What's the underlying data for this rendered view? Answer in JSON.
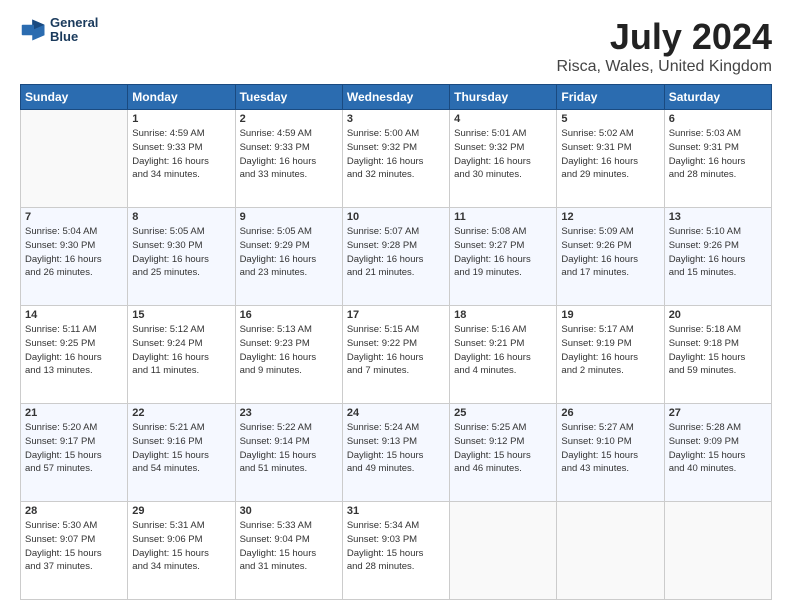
{
  "logo": {
    "line1": "General",
    "line2": "Blue"
  },
  "title": "July 2024",
  "subtitle": "Risca, Wales, United Kingdom",
  "days_of_week": [
    "Sunday",
    "Monday",
    "Tuesday",
    "Wednesday",
    "Thursday",
    "Friday",
    "Saturday"
  ],
  "weeks": [
    [
      {
        "day": "",
        "info": ""
      },
      {
        "day": "1",
        "info": "Sunrise: 4:59 AM\nSunset: 9:33 PM\nDaylight: 16 hours\nand 34 minutes."
      },
      {
        "day": "2",
        "info": "Sunrise: 4:59 AM\nSunset: 9:33 PM\nDaylight: 16 hours\nand 33 minutes."
      },
      {
        "day": "3",
        "info": "Sunrise: 5:00 AM\nSunset: 9:32 PM\nDaylight: 16 hours\nand 32 minutes."
      },
      {
        "day": "4",
        "info": "Sunrise: 5:01 AM\nSunset: 9:32 PM\nDaylight: 16 hours\nand 30 minutes."
      },
      {
        "day": "5",
        "info": "Sunrise: 5:02 AM\nSunset: 9:31 PM\nDaylight: 16 hours\nand 29 minutes."
      },
      {
        "day": "6",
        "info": "Sunrise: 5:03 AM\nSunset: 9:31 PM\nDaylight: 16 hours\nand 28 minutes."
      }
    ],
    [
      {
        "day": "7",
        "info": "Sunrise: 5:04 AM\nSunset: 9:30 PM\nDaylight: 16 hours\nand 26 minutes."
      },
      {
        "day": "8",
        "info": "Sunrise: 5:05 AM\nSunset: 9:30 PM\nDaylight: 16 hours\nand 25 minutes."
      },
      {
        "day": "9",
        "info": "Sunrise: 5:05 AM\nSunset: 9:29 PM\nDaylight: 16 hours\nand 23 minutes."
      },
      {
        "day": "10",
        "info": "Sunrise: 5:07 AM\nSunset: 9:28 PM\nDaylight: 16 hours\nand 21 minutes."
      },
      {
        "day": "11",
        "info": "Sunrise: 5:08 AM\nSunset: 9:27 PM\nDaylight: 16 hours\nand 19 minutes."
      },
      {
        "day": "12",
        "info": "Sunrise: 5:09 AM\nSunset: 9:26 PM\nDaylight: 16 hours\nand 17 minutes."
      },
      {
        "day": "13",
        "info": "Sunrise: 5:10 AM\nSunset: 9:26 PM\nDaylight: 16 hours\nand 15 minutes."
      }
    ],
    [
      {
        "day": "14",
        "info": "Sunrise: 5:11 AM\nSunset: 9:25 PM\nDaylight: 16 hours\nand 13 minutes."
      },
      {
        "day": "15",
        "info": "Sunrise: 5:12 AM\nSunset: 9:24 PM\nDaylight: 16 hours\nand 11 minutes."
      },
      {
        "day": "16",
        "info": "Sunrise: 5:13 AM\nSunset: 9:23 PM\nDaylight: 16 hours\nand 9 minutes."
      },
      {
        "day": "17",
        "info": "Sunrise: 5:15 AM\nSunset: 9:22 PM\nDaylight: 16 hours\nand 7 minutes."
      },
      {
        "day": "18",
        "info": "Sunrise: 5:16 AM\nSunset: 9:21 PM\nDaylight: 16 hours\nand 4 minutes."
      },
      {
        "day": "19",
        "info": "Sunrise: 5:17 AM\nSunset: 9:19 PM\nDaylight: 16 hours\nand 2 minutes."
      },
      {
        "day": "20",
        "info": "Sunrise: 5:18 AM\nSunset: 9:18 PM\nDaylight: 15 hours\nand 59 minutes."
      }
    ],
    [
      {
        "day": "21",
        "info": "Sunrise: 5:20 AM\nSunset: 9:17 PM\nDaylight: 15 hours\nand 57 minutes."
      },
      {
        "day": "22",
        "info": "Sunrise: 5:21 AM\nSunset: 9:16 PM\nDaylight: 15 hours\nand 54 minutes."
      },
      {
        "day": "23",
        "info": "Sunrise: 5:22 AM\nSunset: 9:14 PM\nDaylight: 15 hours\nand 51 minutes."
      },
      {
        "day": "24",
        "info": "Sunrise: 5:24 AM\nSunset: 9:13 PM\nDaylight: 15 hours\nand 49 minutes."
      },
      {
        "day": "25",
        "info": "Sunrise: 5:25 AM\nSunset: 9:12 PM\nDaylight: 15 hours\nand 46 minutes."
      },
      {
        "day": "26",
        "info": "Sunrise: 5:27 AM\nSunset: 9:10 PM\nDaylight: 15 hours\nand 43 minutes."
      },
      {
        "day": "27",
        "info": "Sunrise: 5:28 AM\nSunset: 9:09 PM\nDaylight: 15 hours\nand 40 minutes."
      }
    ],
    [
      {
        "day": "28",
        "info": "Sunrise: 5:30 AM\nSunset: 9:07 PM\nDaylight: 15 hours\nand 37 minutes."
      },
      {
        "day": "29",
        "info": "Sunrise: 5:31 AM\nSunset: 9:06 PM\nDaylight: 15 hours\nand 34 minutes."
      },
      {
        "day": "30",
        "info": "Sunrise: 5:33 AM\nSunset: 9:04 PM\nDaylight: 15 hours\nand 31 minutes."
      },
      {
        "day": "31",
        "info": "Sunrise: 5:34 AM\nSunset: 9:03 PM\nDaylight: 15 hours\nand 28 minutes."
      },
      {
        "day": "",
        "info": ""
      },
      {
        "day": "",
        "info": ""
      },
      {
        "day": "",
        "info": ""
      }
    ]
  ]
}
